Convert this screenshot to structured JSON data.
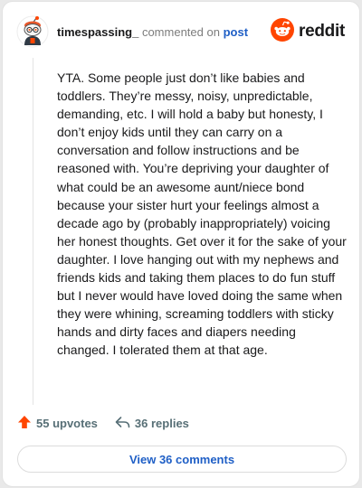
{
  "header": {
    "username": "timespassing_",
    "action": "commented on",
    "post_link": "post",
    "brand": "reddit",
    "avatar_icon": "snoo-avatar-icon",
    "brand_icon": "reddit-logo-icon",
    "brand_color": "#ff4500"
  },
  "comment": {
    "body": "YTA. Some people just don’t like babies and toddlers. They’re messy, noisy, unpredictable, demanding, etc. I will hold a baby but honesty, I don’t enjoy kids until they can carry on a conversation and follow instructions and be reasoned with. You’re depriving your daughter of what could be an awesome aunt/niece bond because your sister hurt your feelings almost a decade ago by (probably inappropriately) voicing her honest thoughts. Get over it for the sake of your daughter. I love hanging out with my nephews and friends kids and taking them places to do fun stuff but I never would have loved doing the same when they were whining, screaming toddlers with sticky hands and dirty faces and diapers needing changed. I tolerated them at that age."
  },
  "stats": {
    "upvotes_label": "55 upvotes",
    "replies_label": "36 replies",
    "upvote_icon": "upvote-arrow-icon",
    "reply_icon": "reply-arrow-icon",
    "upvote_color": "#ff4500"
  },
  "actions": {
    "view_comments_label": "View 36 comments"
  }
}
